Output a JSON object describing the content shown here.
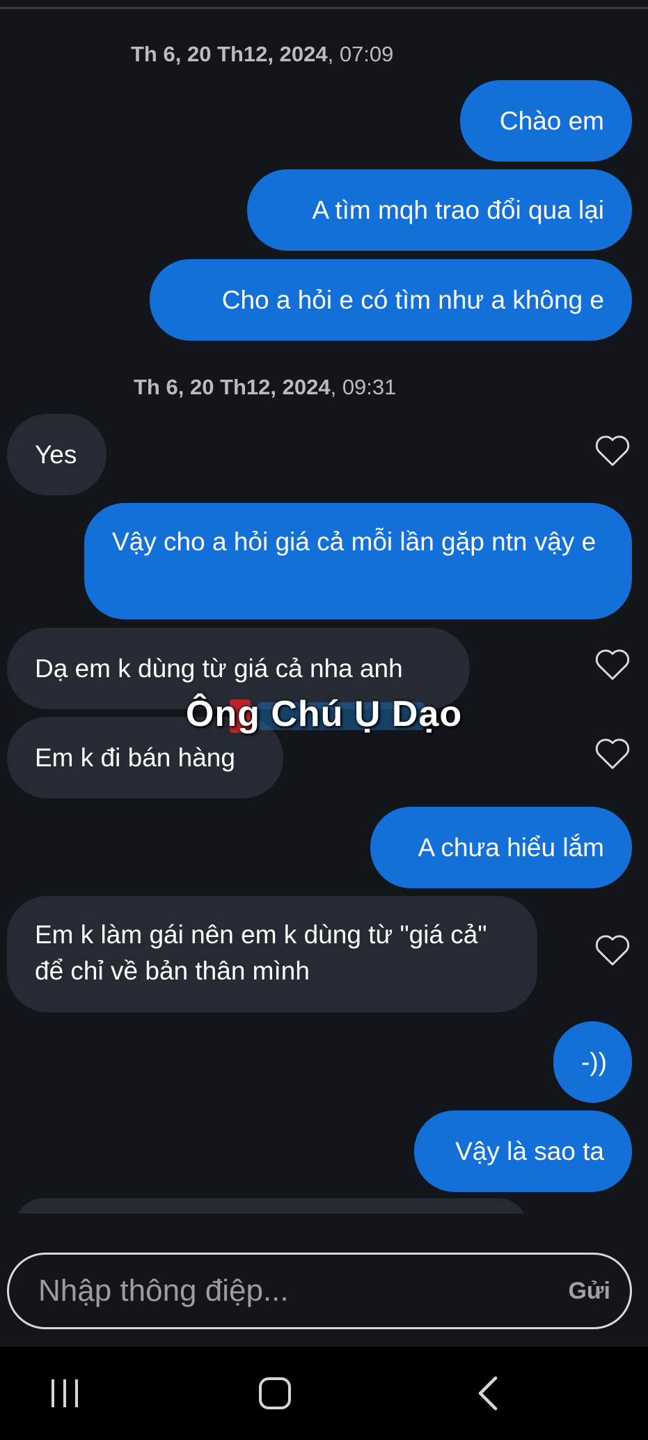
{
  "colors": {
    "background": "#121519",
    "outgoing": "#1470d9",
    "incoming": "#262a32"
  },
  "timestamps": [
    {
      "date": "Th 6, 20 Th12, 2024",
      "time": ", 07:09"
    },
    {
      "date": "Th 6, 20 Th12, 2024",
      "time": ", 09:31"
    }
  ],
  "messages": [
    {
      "dir": "out",
      "text": "Chào em"
    },
    {
      "dir": "out",
      "text": "A tìm mqh trao đổi qua lại"
    },
    {
      "dir": "out",
      "text": "Cho a hỏi e có tìm như a không e"
    },
    {
      "dir": "in",
      "text": "Yes"
    },
    {
      "dir": "out",
      "text": "Vậy cho a hỏi giá cả mỗi lần gặp ntn vậy e"
    },
    {
      "dir": "in",
      "text": "Dạ em k dùng từ giá cả nha anh"
    },
    {
      "dir": "in",
      "text": "Em k đi bán hàng"
    },
    {
      "dir": "out",
      "text": "A chưa hiểu lắm"
    },
    {
      "dir": "in",
      "text": "Em k làm gái nên em k dùng từ \"giá cả\" để chỉ về bản thân mình"
    },
    {
      "dir": "out",
      "text": "-))"
    },
    {
      "dir": "out",
      "text": "Vậy là sao ta"
    }
  ],
  "watermark": "Ông Chú Ụ Dạo",
  "composer": {
    "placeholder": "Nhập thông điệp...",
    "send_label": "Gửi"
  },
  "icons": {
    "like": "heart-outline-icon",
    "nav_recents": "recent-apps-icon",
    "nav_home": "home-icon",
    "nav_back": "back-icon"
  }
}
